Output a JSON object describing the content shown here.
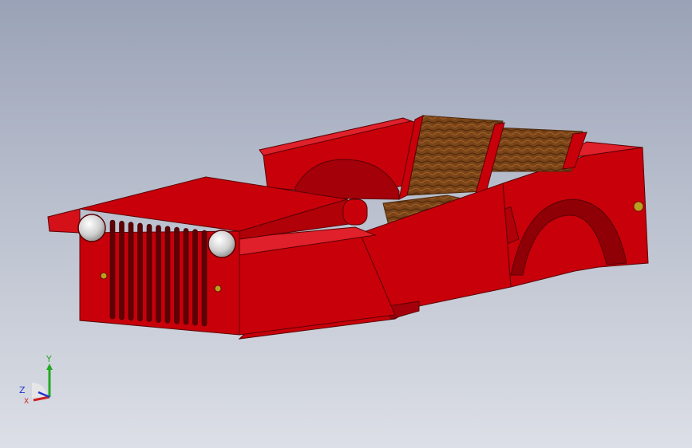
{
  "view": {
    "title": "",
    "background_top": "#9aa2b7",
    "background_bottom": "#dcdfe6"
  },
  "model": {
    "body_color": "#c8000a",
    "body_dark": "#8e0006",
    "body_light": "#e0202a",
    "seat_color": "#7a4418",
    "seat_dark": "#4e2a0c",
    "lamp_color": "#d8d8d8",
    "indicator_color": "#b8a020"
  },
  "triad": {
    "y_label": "Y",
    "z_label": "Z",
    "x_label": "X",
    "y_color": "#22aa22",
    "z_color": "#2233cc",
    "x_color": "#cc2222"
  }
}
